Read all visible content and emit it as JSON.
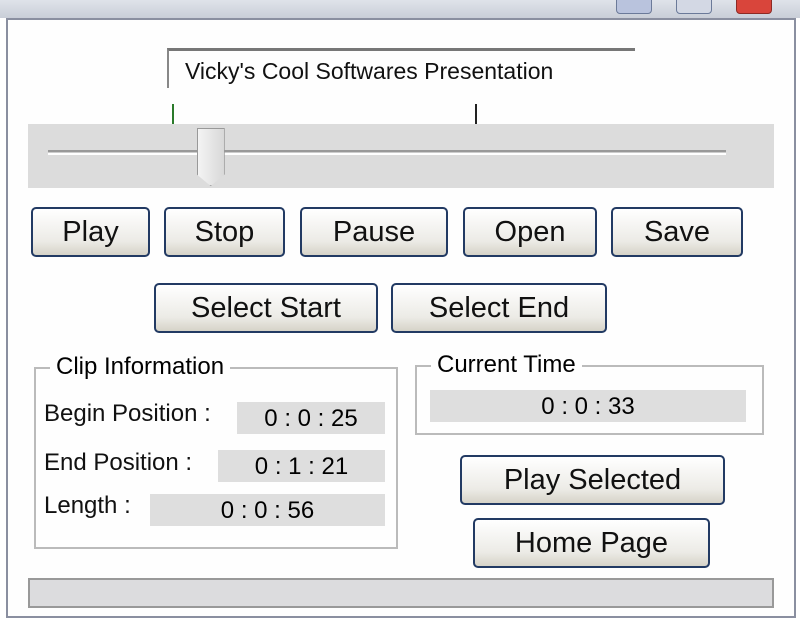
{
  "window": {
    "controls": [
      "minimize",
      "maximize",
      "close"
    ]
  },
  "caption": "Vicky's Cool Softwares Presentation",
  "slider": {
    "position_fraction": 0.24
  },
  "buttons": {
    "play": "Play",
    "stop": "Stop",
    "pause": "Pause",
    "open": "Open",
    "save": "Save",
    "select_start": "Select Start",
    "select_end": "Select End",
    "play_selected": "Play Selected",
    "home_page": "Home Page"
  },
  "clip_info": {
    "title": "Clip Information",
    "begin_label": "Begin Position :",
    "begin_value": "0 : 0 : 25",
    "end_label": "End Position :",
    "end_value": "0 : 1 : 21",
    "length_label": "Length :",
    "length_value": "0 : 0 : 56"
  },
  "current_time": {
    "title": "Current Time",
    "value": "0 : 0 : 33"
  }
}
